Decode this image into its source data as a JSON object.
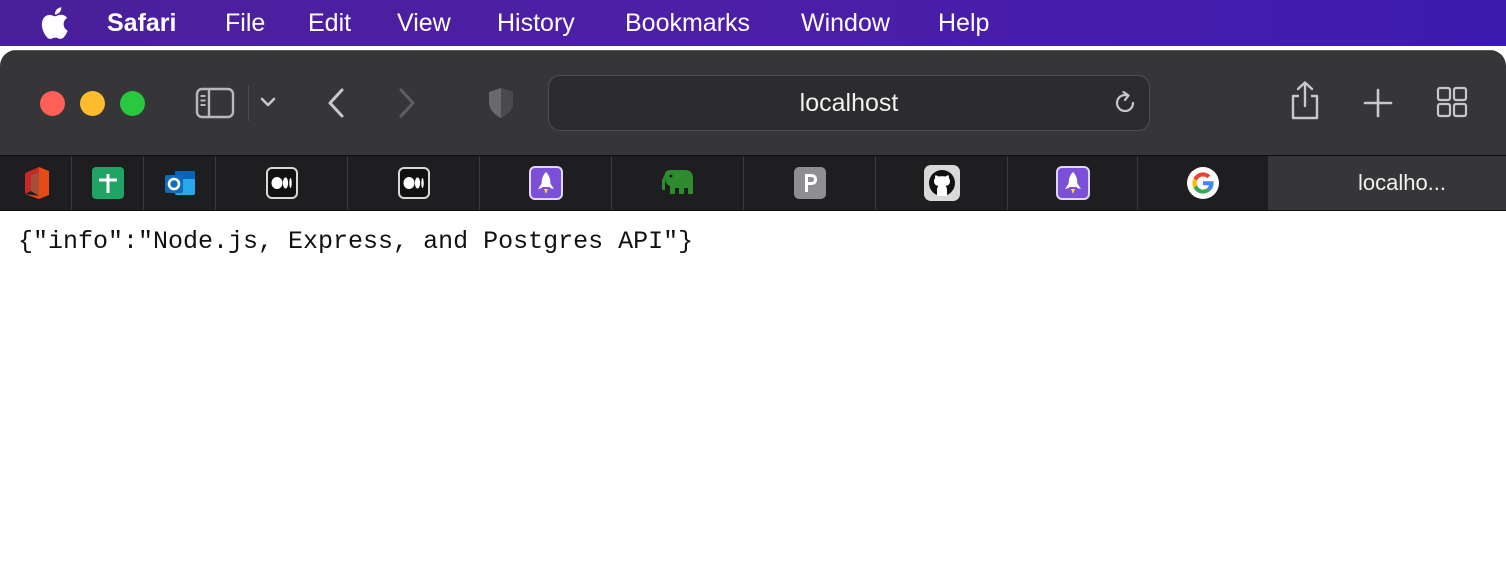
{
  "menubar": {
    "app_name": "Safari",
    "items": [
      "File",
      "Edit",
      "View",
      "History",
      "Bookmarks",
      "Window",
      "Help"
    ]
  },
  "toolbar": {
    "url": "localhost",
    "icons": [
      "sidebar-icon",
      "chevron-down-icon",
      "back-icon",
      "forward-icon",
      "privacy-shield-icon",
      "reload-icon",
      "share-icon",
      "new-tab-icon",
      "tab-overview-icon"
    ]
  },
  "tabs": {
    "pinned": [
      {
        "icon": "office-icon"
      },
      {
        "icon": "google-sheets-icon"
      },
      {
        "icon": "outlook-icon"
      },
      {
        "icon": "medium-icon"
      },
      {
        "icon": "medium-icon"
      },
      {
        "icon": "rocket-icon"
      },
      {
        "icon": "elephant-icon"
      },
      {
        "icon": "p-letter-icon"
      },
      {
        "icon": "github-icon"
      },
      {
        "icon": "rocket-icon"
      },
      {
        "icon": "google-icon"
      }
    ],
    "active": {
      "label": "localho..."
    }
  },
  "page": {
    "body_text": "{\"info\":\"Node.js, Express, and Postgres API\"}"
  },
  "colors": {
    "menubar": "#4d1fa6",
    "toolbar": "#363538",
    "tabbar": "#1e1e20"
  }
}
